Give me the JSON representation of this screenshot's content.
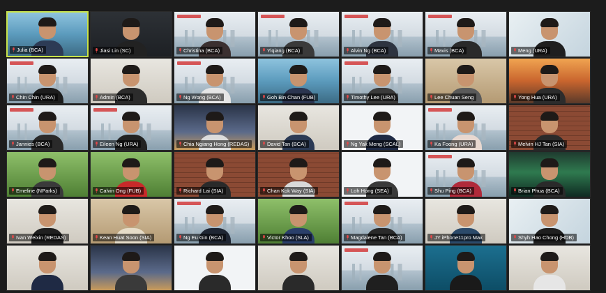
{
  "meeting": {
    "participants": [
      {
        "name": "Julia (BCA)",
        "bg": "bg-sea",
        "shirt": "#2d3b55",
        "active": true
      },
      {
        "name": "Jiasi Lin (SC)",
        "bg": "bg-dark",
        "shirt": "#222"
      },
      {
        "name": "Christina (BCA)",
        "bg": "bg-skyline",
        "shirt": "#3b3030"
      },
      {
        "name": "Yiqiang (BCA)",
        "bg": "bg-skyline",
        "shirt": "#3a3a3a"
      },
      {
        "name": "Alvin Ng (BCA)",
        "bg": "bg-skyline",
        "shirt": "#2e3440"
      },
      {
        "name": "Mavis (BCA)",
        "bg": "bg-skyline",
        "shirt": "#2a2a2a"
      },
      {
        "name": "Meng (URA)",
        "bg": "bg-poster",
        "shirt": "#1f1f1f"
      },
      {
        "name": "Chin Chin (URA)",
        "bg": "bg-skyline",
        "shirt": "#1d1d1d"
      },
      {
        "name": "Admin (BCA)",
        "bg": "bg-office",
        "shirt": "#2c2c2c"
      },
      {
        "name": "Ng Wong (BCA)",
        "bg": "bg-skyline",
        "shirt": "#e6e6e6"
      },
      {
        "name": "Goh Bin Chan (FUB)",
        "bg": "bg-sea",
        "shirt": "#2b3550"
      },
      {
        "name": "Timothy Lee (URA)",
        "bg": "bg-skyline",
        "shirt": "#3b3b3b"
      },
      {
        "name": "Lee Chuan Seng",
        "bg": "bg-wood",
        "shirt": "#5a5a5a"
      },
      {
        "name": "Yong Hua (URA)",
        "bg": "bg-sunset",
        "shirt": "#2c2c2c"
      },
      {
        "name": "Jannies (BCA)",
        "bg": "bg-skyline",
        "shirt": "#2a2a2a"
      },
      {
        "name": "Eileen Ng (URA)",
        "bg": "bg-skyline",
        "shirt": "#222"
      },
      {
        "name": "Chia Ngiang Hong (REDAS)",
        "bg": "bg-night",
        "shirt": "#dcdcdc"
      },
      {
        "name": "David Tan (BCA)",
        "bg": "bg-office",
        "shirt": "#2b3a55"
      },
      {
        "name": "Ng Yak Meng (SCAL)",
        "bg": "bg-white",
        "shirt": "#1f2a44"
      },
      {
        "name": "Ka Foong (URA)",
        "bg": "bg-skyline",
        "shirt": "#e8d8d0"
      },
      {
        "name": "Melvin HJ Tan (SIA)",
        "bg": "bg-brick",
        "shirt": "#2a2a2a"
      },
      {
        "name": "Emeline (NParks)",
        "bg": "bg-green",
        "shirt": "#3a3a3a"
      },
      {
        "name": "Calvin Ong (FUB)",
        "bg": "bg-green",
        "shirt": "#c82a2a"
      },
      {
        "name": "Richard Lai (SIA)",
        "bg": "bg-brick",
        "shirt": "#2a2a2a"
      },
      {
        "name": "Chan Kok Way (SIA)",
        "bg": "bg-brick",
        "shirt": "#d9d9d9"
      },
      {
        "name": "Loh Hong (SEA)",
        "bg": "bg-white",
        "shirt": "#3a3a3a"
      },
      {
        "name": "Shu Ping (BCA)",
        "bg": "bg-skyline",
        "shirt": "#b02a3a"
      },
      {
        "name": "Brian Phua (BCA)",
        "bg": "bg-aurora",
        "shirt": "#2a2a2a"
      },
      {
        "name": "Ivan Weixin (REDAS)",
        "bg": "bg-office",
        "shirt": "#1f1f1f"
      },
      {
        "name": "Kean Huat Soon (SIA)",
        "bg": "bg-wood",
        "shirt": "#e6dcc8"
      },
      {
        "name": "Ng Eu Gin (BCA)",
        "bg": "bg-skyline",
        "shirt": "#1f2633"
      },
      {
        "name": "Victor Khoo (SLA)",
        "bg": "bg-green",
        "shirt": "#2a3f6a"
      },
      {
        "name": "Magdalene Tan (BCA)",
        "bg": "bg-skyline",
        "shirt": "#2a2a2a"
      },
      {
        "name": "JY iPhone11pro Max",
        "bg": "bg-office",
        "shirt": "#2b4a6a"
      },
      {
        "name": "Shyh Hao Chong (HDB)",
        "bg": "bg-poster",
        "shirt": "#1f1f1f"
      },
      {
        "name": "",
        "bg": "bg-office",
        "shirt": "#1f2a44"
      },
      {
        "name": "",
        "bg": "bg-night",
        "shirt": "#3a3a3a"
      },
      {
        "name": "",
        "bg": "bg-white",
        "shirt": "#2a2a2a"
      },
      {
        "name": "",
        "bg": "bg-office",
        "shirt": "#2a2a2a"
      },
      {
        "name": "",
        "bg": "bg-skyline",
        "shirt": "#1f1f1f"
      },
      {
        "name": "",
        "bg": "bg-teal",
        "shirt": "#1a1a1a"
      },
      {
        "name": "",
        "bg": "bg-office",
        "shirt": "#e6e6e6"
      }
    ]
  }
}
